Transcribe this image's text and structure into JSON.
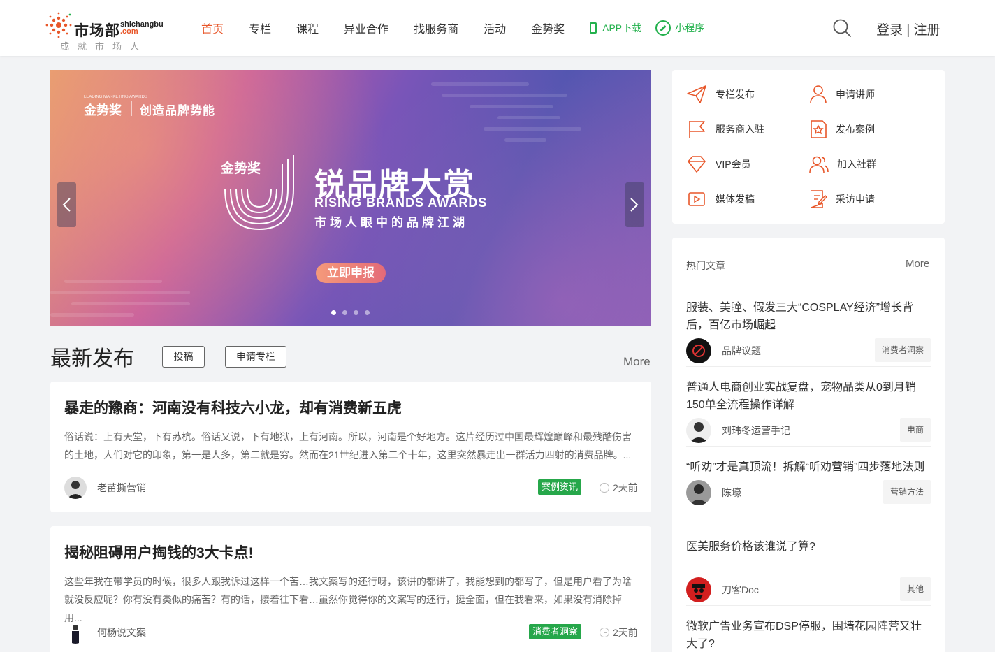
{
  "header": {
    "logo": {
      "cn": "市场部",
      "en_top": "shichangbu",
      "en_bottom": ".com",
      "slogan": "成就市场人"
    },
    "nav": [
      {
        "label": "首页",
        "active": true
      },
      {
        "label": "专栏",
        "active": false
      },
      {
        "label": "课程",
        "active": false
      },
      {
        "label": "异业合作",
        "active": false
      },
      {
        "label": "找服务商",
        "active": false
      },
      {
        "label": "活动",
        "active": false
      },
      {
        "label": "金势奖",
        "active": false
      }
    ],
    "app_download": "APP下载",
    "mini_program": "小程序",
    "auth": "登录 | 注册",
    "accent_color": "#e8572a",
    "green_color": "#23b14d"
  },
  "banner": {
    "small_logo_line": "LEADING MARKETING AWARDS",
    "small_logo": "金势奖",
    "tagline": "创造品牌势能",
    "center_logo": "金势奖",
    "title": "锐品牌大赏",
    "title_en": "RISING BRANDS AWARDS",
    "subtitle": "市场人眼中的品牌江湖",
    "cta": "立即申报",
    "slide_count": 4,
    "active_slide": 1
  },
  "latest": {
    "title": "最新发布",
    "submit_button": "投稿",
    "apply_button": "申请专栏",
    "more": "More",
    "articles": [
      {
        "title": "暴走的豫商：河南没有科技六小龙，却有消费新五虎",
        "excerpt": "俗话说：上有天堂，下有苏杭。俗话又说，下有地狱，上有河南。所以，河南是个好地方。这片经历过中国最辉煌巅峰和最残酷伤害的土地，人们对它的印象，第一是人多，第二就是穷。然而在21世纪进入第二个十年，这里突然暴走出一群活力四射的消费品牌。...",
        "author": "老苗撕营销",
        "tag": "案例资讯",
        "time": "2天前"
      },
      {
        "title": "揭秘阻碍用户掏钱的3大卡点!",
        "excerpt": "这些年我在带学员的时候，很多人跟我诉过这样一个苦…我文案写的还行呀，该讲的都讲了，我能想到的都写了，但是用户看了为啥就没反应呢？你有没有类似的痛苦？有的话，接着往下看…虽然你觉得你的文案写的还行，挺全面，但在我看来，如果没有消除掉用...",
        "author": "何杨说文案",
        "tag": "消费者洞察",
        "time": "2天前"
      }
    ]
  },
  "actions": [
    {
      "label": "专栏发布",
      "icon": "paper-plane-icon"
    },
    {
      "label": "申请讲师",
      "icon": "user-icon"
    },
    {
      "label": "服务商入驻",
      "icon": "flag-icon"
    },
    {
      "label": "发布案例",
      "icon": "star-doc-icon"
    },
    {
      "label": "VIP会员",
      "icon": "diamond-icon"
    },
    {
      "label": "加入社群",
      "icon": "group-icon"
    },
    {
      "label": "媒体发稿",
      "icon": "play-icon"
    },
    {
      "label": "采访申请",
      "icon": "edit-doc-icon"
    }
  ],
  "hot": {
    "title": "热门文章",
    "more": "More",
    "items": [
      {
        "title": "服装、美瞳、假发三大“COSPLAY经济”增长背后，百亿市场崛起",
        "author": "品牌议题",
        "tag": "消费者洞察"
      },
      {
        "title": "普通人电商创业实战复盘，宠物品类从0到月销150单全流程操作详解",
        "author": "刘玮冬运营手记",
        "tag": "电商"
      },
      {
        "title": "“听劝”才是真顶流！拆解“听劝营销”四步落地法则",
        "author": "陈壕",
        "tag": "营销方法"
      },
      {
        "title": "医美服务价格该谁说了算?",
        "author": "刀客Doc",
        "tag": "其他"
      },
      {
        "title": "微软广告业务宣布DSP停服，围墙花园阵营又壮大了?",
        "author": "",
        "tag": ""
      }
    ]
  }
}
